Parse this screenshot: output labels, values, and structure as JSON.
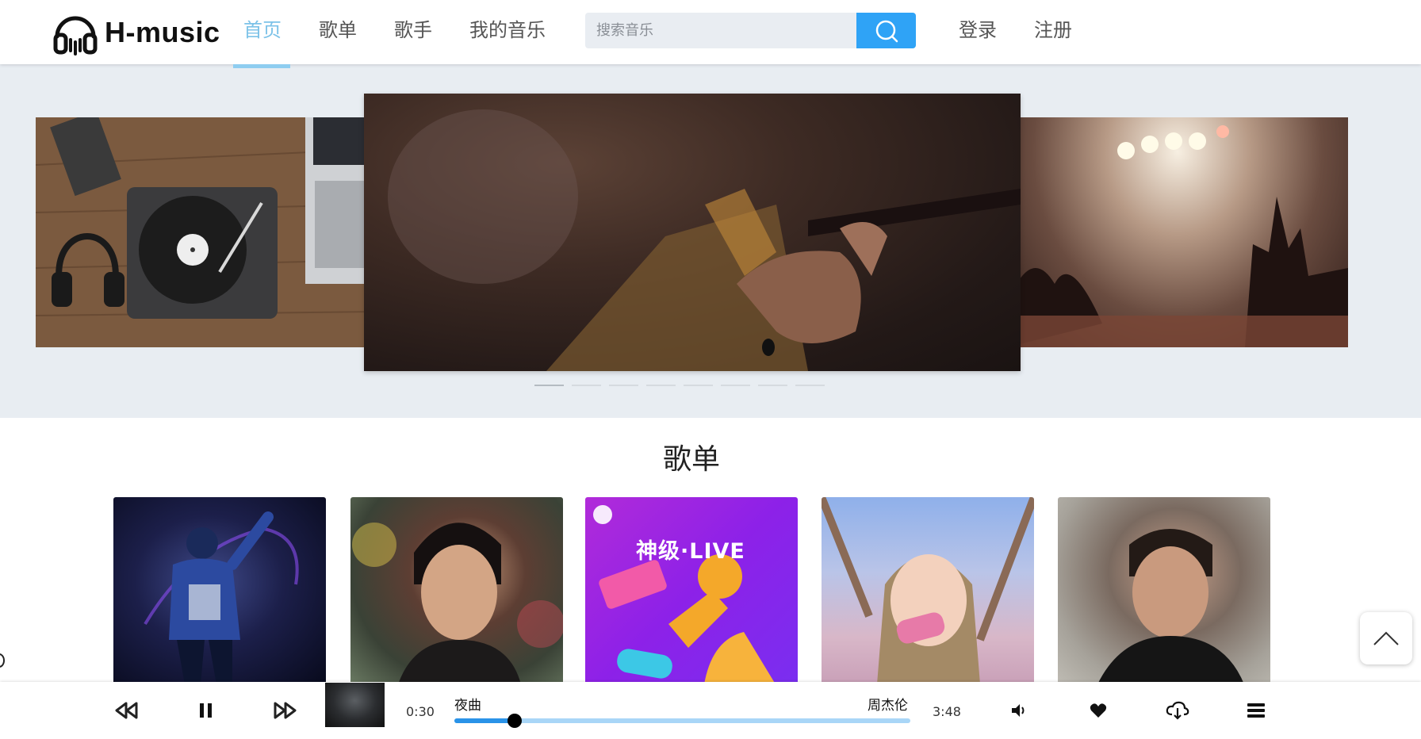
{
  "header": {
    "logo_text": "H-music",
    "nav": [
      {
        "label": "首页",
        "active": true
      },
      {
        "label": "歌单",
        "active": false
      },
      {
        "label": "歌手",
        "active": false
      },
      {
        "label": "我的音乐",
        "active": false
      }
    ],
    "search_placeholder": "搜索音乐",
    "login_label": "登录",
    "register_label": "注册"
  },
  "banner": {
    "slides": [
      {
        "name": "turntable-desk-image"
      },
      {
        "name": "guitar-player-image"
      },
      {
        "name": "concert-crowd-image"
      }
    ],
    "dot_count": 8,
    "active_dot": 0
  },
  "playlists": {
    "title": "歌单",
    "cards": [
      {
        "name": "playlist-dancer-cover"
      },
      {
        "name": "playlist-singer-portrait-cover"
      },
      {
        "name": "playlist-live-cover",
        "overlay_text": "神级·LIVE"
      },
      {
        "name": "playlist-girl-cover"
      },
      {
        "name": "playlist-man-portrait-cover"
      }
    ]
  },
  "player": {
    "current_time": "0:30",
    "duration": "3:48",
    "song_title": "夜曲",
    "artist": "周杰伦",
    "progress_percent": 13.2
  },
  "colors": {
    "accent": "#2fa3f6",
    "nav_active": "#7cc2e8",
    "progress_fill": "#2a93e8",
    "progress_track": "#a9d6f7",
    "banner_bg": "#e8edf2"
  },
  "icons": {
    "logo": "headphones-icon",
    "search": "search-icon",
    "prev": "rewind-icon",
    "pause": "pause-icon",
    "next": "fast-forward-icon",
    "volume": "volume-icon",
    "like": "heart-icon",
    "download": "cloud-download-icon",
    "playlist": "menu-icon",
    "back_to_top": "chevron-up-icon"
  }
}
